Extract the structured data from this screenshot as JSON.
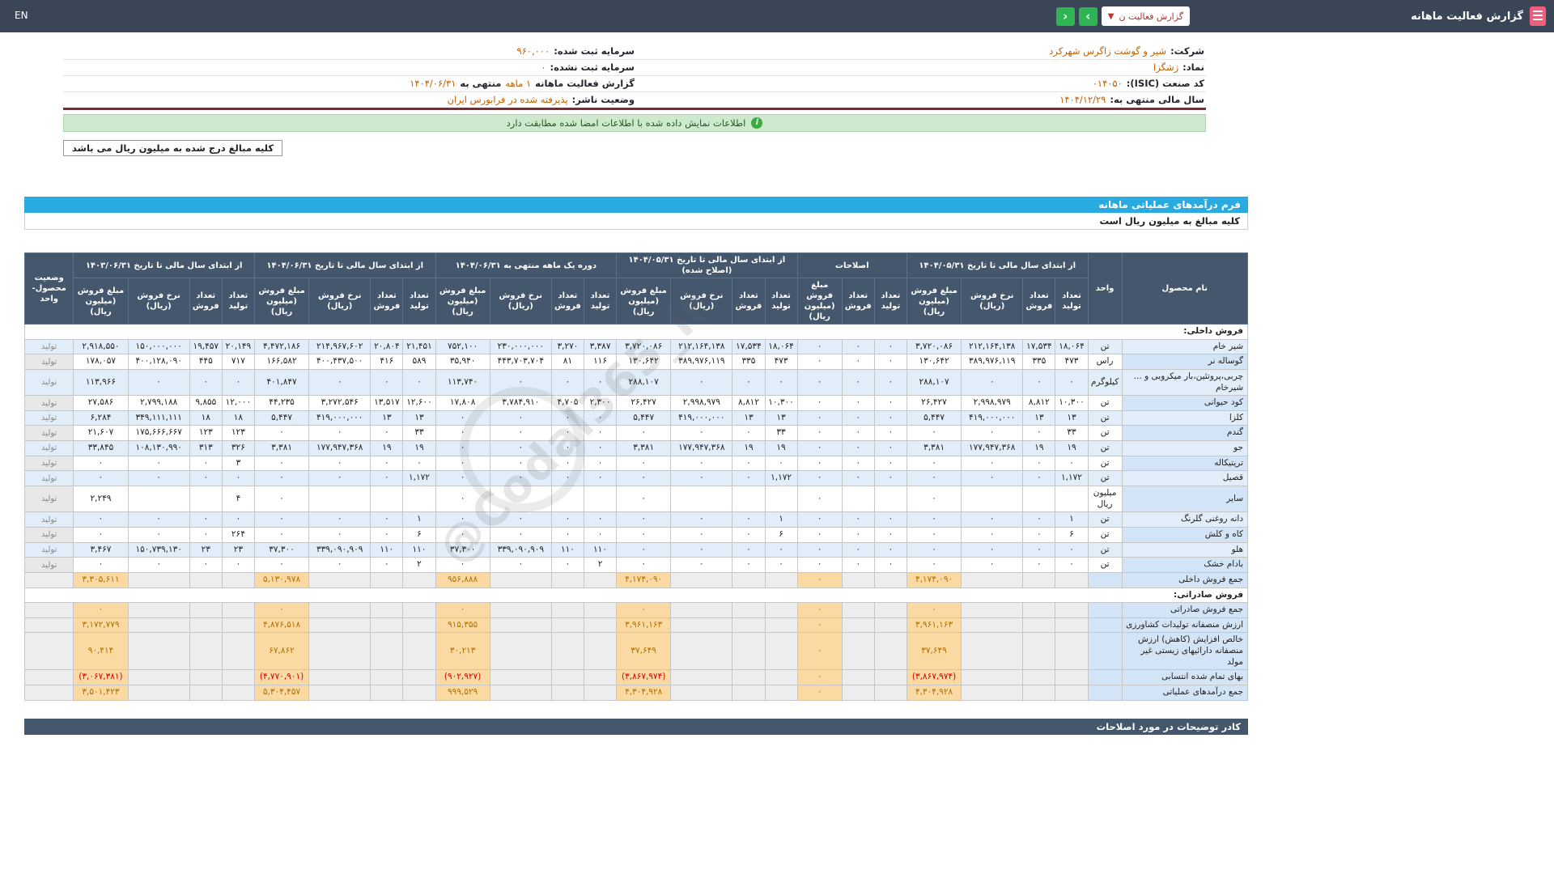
{
  "topbar": {
    "title": "گزارش فعالیت ماهانه",
    "dropdown_label": "گزارش فعالیت ن",
    "dropdown_caret": "▼",
    "nav_forward": "›",
    "nav_back": "‹",
    "lang": "EN"
  },
  "info_rows": [
    {
      "right": [
        [
          "شرکت:",
          "l"
        ],
        [
          "شیر و گوشت زاگرس شهرکرد",
          "v"
        ]
      ],
      "left": [
        [
          "سرمایه ثبت شده:",
          "l"
        ],
        [
          "۹۶۰,۰۰۰",
          "v"
        ]
      ]
    },
    {
      "right": [
        [
          "نماد:",
          "l"
        ],
        [
          "زشگزا",
          "v"
        ]
      ],
      "left": [
        [
          "سرمایه ثبت نشده:",
          "l"
        ],
        [
          "۰",
          "v"
        ]
      ]
    },
    {
      "right": [
        [
          "کد صنعت (ISIC):",
          "l"
        ],
        [
          "۰۱۴۰۵۰",
          "v"
        ]
      ],
      "left": [
        [
          "گزارش فعالیت ماهانه",
          "l"
        ],
        [
          "۱ ماهه",
          "v"
        ],
        [
          "منتهی به",
          "l"
        ],
        [
          "۱۴۰۴/۰۶/۳۱",
          "v"
        ]
      ]
    },
    {
      "right": [
        [
          "سال مالی منتهی به:",
          "l"
        ],
        [
          "۱۴۰۴/۱۲/۲۹",
          "v"
        ]
      ],
      "left": [
        [
          "وضعیت ناشر:",
          "l"
        ],
        [
          "پذیرفته شده در فرابورس ایران",
          "v"
        ]
      ]
    }
  ],
  "notice": "اطلاعات نمایش داده شده با اطلاعات امضا شده مطابقت دارد",
  "amounts_note_box": "کلیه مبالغ درج شده به میلیون ریال می باشد",
  "form": {
    "title": "فرم درآمدهای عملیاتی ماهانه",
    "subtitle": "کلیه مبالغ به میلیون ریال است"
  },
  "table": {
    "col_product": "نام محصول",
    "col_unit": "واحد",
    "col_status": "وضعیت محصول-واحد",
    "sub_headers": [
      "تعداد تولید",
      "تعداد فروش",
      "نرخ فروش (ریال)",
      "مبلغ فروش (میلیون ریال)"
    ],
    "adj_sub_headers": [
      "تعداد تولید",
      "تعداد فروش",
      "مبلغ فروش (میلیون ریال)"
    ],
    "groups": [
      "از ابتدای سال مالی تا تاریخ ۱۴۰۴/۰۵/۳۱",
      "اصلاحات",
      "از ابتدای سال مالی تا تاریخ ۱۴۰۴/۰۵/۳۱ (اصلاح شده)",
      "دوره یک ماهه منتهی به ۱۴۰۴/۰۶/۳۱",
      "از ابتدای سال مالی تا تاریخ ۱۴۰۴/۰۶/۳۱",
      "از ابتدای سال مالی تا تاریخ ۱۴۰۳/۰۶/۳۱"
    ],
    "rows": [
      {
        "type": "section",
        "label": "فروش داخلی:"
      },
      {
        "type": "product",
        "name": "شیر خام",
        "unit": "تن",
        "g1": [
          "۱۸,۰۶۴",
          "۱۷,۵۳۴",
          "۲۱۲,۱۶۴,۱۳۸",
          "۳,۷۲۰,۰۸۶"
        ],
        "adj": [
          "۰",
          "۰",
          "۰"
        ],
        "g2": [
          "۱۸,۰۶۴",
          "۱۷,۵۳۴",
          "۲۱۲,۱۶۴,۱۳۸",
          "۳,۷۲۰,۰۸۶"
        ],
        "month": [
          "۳,۳۸۷",
          "۳,۲۷۰",
          "۲۳۰,۰۰۰,۰۰۰",
          "۷۵۲,۱۰۰"
        ],
        "ytd": [
          "۲۱,۴۵۱",
          "۲۰,۸۰۴",
          "۲۱۴,۹۶۷,۶۰۲",
          "۴,۴۷۲,۱۸۶"
        ],
        "prev": [
          "۲۰,۱۴۹",
          "۱۹,۴۵۷",
          "۱۵۰,۰۰۰,۰۰۰",
          "۲,۹۱۸,۵۵۰"
        ],
        "status": "تولید"
      },
      {
        "type": "product",
        "name": "گوساله نر",
        "unit": "راس",
        "g1": [
          "۴۷۳",
          "۳۳۵",
          "۳۸۹,۹۷۶,۱۱۹",
          "۱۳۰,۶۴۲"
        ],
        "adj": [
          "۰",
          "۰",
          "۰"
        ],
        "g2": [
          "۴۷۳",
          "۳۳۵",
          "۳۸۹,۹۷۶,۱۱۹",
          "۱۳۰,۶۴۲"
        ],
        "month": [
          "۱۱۶",
          "۸۱",
          "۴۴۳,۷۰۳,۷۰۴",
          "۳۵,۹۴۰"
        ],
        "ytd": [
          "۵۸۹",
          "۴۱۶",
          "۴۰۰,۴۳۷,۵۰۰",
          "۱۶۶,۵۸۲"
        ],
        "prev": [
          "۷۱۷",
          "۴۴۵",
          "۴۰۰,۱۲۸,۰۹۰",
          "۱۷۸,۰۵۷"
        ],
        "status": "تولید"
      },
      {
        "type": "product",
        "name": "چربی،پروتئین،بار میکروبی و ... شیرخام",
        "unit": "کیلوگرم",
        "g1": [
          "۰",
          "۰",
          "۰",
          "۲۸۸,۱۰۷"
        ],
        "adj": [
          "۰",
          "۰",
          "۰"
        ],
        "g2": [
          "۰",
          "۰",
          "۰",
          "۲۸۸,۱۰۷"
        ],
        "month": [
          "۰",
          "۰",
          "۰",
          "۱۱۳,۷۴۰"
        ],
        "ytd": [
          "۰",
          "۰",
          "۰",
          "۴۰۱,۸۴۷"
        ],
        "prev": [
          "۰",
          "۰",
          "۰",
          "۱۱۳,۹۶۶"
        ],
        "status": "تولید"
      },
      {
        "type": "product",
        "name": "کود حیوانی",
        "unit": "تن",
        "g1": [
          "۱۰,۳۰۰",
          "۸,۸۱۲",
          "۲,۹۹۸,۹۷۹",
          "۲۶,۴۲۷"
        ],
        "adj": [
          "۰",
          "۰",
          "۰"
        ],
        "g2": [
          "۱۰,۳۰۰",
          "۸,۸۱۲",
          "۲,۹۹۸,۹۷۹",
          "۲۶,۴۲۷"
        ],
        "month": [
          "۲,۳۰۰",
          "۴,۷۰۵",
          "۳,۷۸۴,۹۱۰",
          "۱۷,۸۰۸"
        ],
        "ytd": [
          "۱۲,۶۰۰",
          "۱۳,۵۱۷",
          "۳,۲۷۲,۵۴۶",
          "۴۴,۲۳۵"
        ],
        "prev": [
          "۱۲,۰۰۰",
          "۹,۸۵۵",
          "۲,۷۹۹,۱۸۸",
          "۲۷,۵۸۶"
        ],
        "status": "تولید"
      },
      {
        "type": "product",
        "name": "کلزا",
        "unit": "تن",
        "g1": [
          "۱۳",
          "۱۳",
          "۴۱۹,۰۰۰,۰۰۰",
          "۵,۴۴۷"
        ],
        "adj": [
          "۰",
          "۰",
          "۰"
        ],
        "g2": [
          "۱۳",
          "۱۳",
          "۴۱۹,۰۰۰,۰۰۰",
          "۵,۴۴۷"
        ],
        "month": [
          "۰",
          "۰",
          "۰",
          "۰"
        ],
        "ytd": [
          "۱۳",
          "۱۳",
          "۴۱۹,۰۰۰,۰۰۰",
          "۵,۴۴۷"
        ],
        "prev": [
          "۱۸",
          "۱۸",
          "۳۴۹,۱۱۱,۱۱۱",
          "۶,۲۸۴"
        ],
        "status": "تولید"
      },
      {
        "type": "product",
        "name": "گندم",
        "unit": "تن",
        "g1": [
          "۳۳",
          "۰",
          "۰",
          "۰"
        ],
        "adj": [
          "۰",
          "۰",
          "۰"
        ],
        "g2": [
          "۳۳",
          "۰",
          "۰",
          "۰"
        ],
        "month": [
          "۰",
          "۰",
          "۰",
          "۰"
        ],
        "ytd": [
          "۳۳",
          "۰",
          "۰",
          "۰"
        ],
        "prev": [
          "۱۲۳",
          "۱۲۳",
          "۱۷۵,۶۶۶,۶۶۷",
          "۲۱,۶۰۷"
        ],
        "status": "تولید"
      },
      {
        "type": "product",
        "name": "جو",
        "unit": "تن",
        "g1": [
          "۱۹",
          "۱۹",
          "۱۷۷,۹۴۷,۳۶۸",
          "۳,۳۸۱"
        ],
        "adj": [
          "۰",
          "۰",
          "۰"
        ],
        "g2": [
          "۱۹",
          "۱۹",
          "۱۷۷,۹۴۷,۳۶۸",
          "۳,۳۸۱"
        ],
        "month": [
          "۰",
          "۰",
          "۰",
          "۰"
        ],
        "ytd": [
          "۱۹",
          "۱۹",
          "۱۷۷,۹۴۷,۳۶۸",
          "۳,۳۸۱"
        ],
        "prev": [
          "۳۲۶",
          "۳۱۳",
          "۱۰۸,۱۳۰,۹۹۰",
          "۳۳,۸۴۵"
        ],
        "status": "تولید"
      },
      {
        "type": "product",
        "name": "تریتیکاله",
        "unit": "تن",
        "g1": [
          "۰",
          "۰",
          "۰",
          "۰"
        ],
        "adj": [
          "۰",
          "۰",
          "۰"
        ],
        "g2": [
          "۰",
          "۰",
          "۰",
          "۰"
        ],
        "month": [
          "۰",
          "۰",
          "۰",
          "۰"
        ],
        "ytd": [
          "۰",
          "۰",
          "۰",
          "۰"
        ],
        "prev": [
          "۳",
          "۰",
          "۰",
          "۰"
        ],
        "status": "تولید"
      },
      {
        "type": "product",
        "name": "قصیل",
        "unit": "تن",
        "g1": [
          "۱,۱۷۲",
          "۰",
          "۰",
          "۰"
        ],
        "adj": [
          "۰",
          "۰",
          "۰"
        ],
        "g2": [
          "۱,۱۷۲",
          "۰",
          "۰",
          "۰"
        ],
        "month": [
          "۰",
          "۰",
          "۰",
          "۰"
        ],
        "ytd": [
          "۱,۱۷۲",
          "۰",
          "۰",
          "۰"
        ],
        "prev": [
          "۰",
          "۰",
          "۰",
          "۰"
        ],
        "status": "تولید"
      },
      {
        "type": "product",
        "name": "سایر",
        "unit": "میلیون ریال",
        "g1": [
          "",
          "",
          "",
          "۰"
        ],
        "adj": [
          "",
          "",
          "۰"
        ],
        "g2": [
          "",
          "",
          "",
          "۰"
        ],
        "month": [
          "",
          "",
          "",
          "۰"
        ],
        "ytd": [
          "",
          "",
          "",
          "۰"
        ],
        "prev": [
          "۴",
          "",
          "",
          "۲,۲۴۹"
        ],
        "status": "تولید"
      },
      {
        "type": "product",
        "name": "دانه روغنی گلرنگ",
        "unit": "تن",
        "g1": [
          "۱",
          "۰",
          "۰",
          "۰"
        ],
        "adj": [
          "۰",
          "۰",
          "۰"
        ],
        "g2": [
          "۱",
          "۰",
          "۰",
          "۰"
        ],
        "month": [
          "۰",
          "۰",
          "۰",
          "۰"
        ],
        "ytd": [
          "۱",
          "۰",
          "۰",
          "۰"
        ],
        "prev": [
          "۰",
          "۰",
          "۰",
          "۰"
        ],
        "status": "تولید"
      },
      {
        "type": "product",
        "name": "کاه و کلش",
        "unit": "تن",
        "g1": [
          "۶",
          "۰",
          "۰",
          "۰"
        ],
        "adj": [
          "۰",
          "۰",
          "۰"
        ],
        "g2": [
          "۶",
          "۰",
          "۰",
          "۰"
        ],
        "month": [
          "۰",
          "۰",
          "۰",
          "۰"
        ],
        "ytd": [
          "۶",
          "۰",
          "۰",
          "۰"
        ],
        "prev": [
          "۲۶۴",
          "۰",
          "۰",
          "۰"
        ],
        "status": "تولید"
      },
      {
        "type": "product",
        "name": "هلو",
        "unit": "تن",
        "g1": [
          "۰",
          "۰",
          "۰",
          "۰"
        ],
        "adj": [
          "۰",
          "۰",
          "۰"
        ],
        "g2": [
          "۰",
          "۰",
          "۰",
          "۰"
        ],
        "month": [
          "۱۱۰",
          "۱۱۰",
          "۳۳۹,۰۹۰,۹۰۹",
          "۳۷,۳۰۰"
        ],
        "ytd": [
          "۱۱۰",
          "۱۱۰",
          "۳۳۹,۰۹۰,۹۰۹",
          "۳۷,۳۰۰"
        ],
        "prev": [
          "۲۳",
          "۲۳",
          "۱۵۰,۷۳۹,۱۳۰",
          "۳,۴۶۷"
        ],
        "status": "تولید"
      },
      {
        "type": "product",
        "name": "بادام خشک",
        "unit": "تن",
        "g1": [
          "۰",
          "۰",
          "۰",
          "۰"
        ],
        "adj": [
          "۰",
          "۰",
          "۰"
        ],
        "g2": [
          "۰",
          "۰",
          "۰",
          "۰"
        ],
        "month": [
          "۲",
          "۰",
          "۰",
          "۰"
        ],
        "ytd": [
          "۲",
          "۰",
          "۰",
          "۰"
        ],
        "prev": [
          "۰",
          "۰",
          "۰",
          "۰"
        ],
        "status": "تولید"
      },
      {
        "type": "total",
        "label": "جمع فروش داخلی",
        "g1": "۴,۱۷۴,۰۹۰",
        "adj": "۰",
        "g2": "۴,۱۷۴,۰۹۰",
        "month": "۹۵۶,۸۸۸",
        "ytd": "۵,۱۳۰,۹۷۸",
        "prev": "۳,۳۰۵,۶۱۱"
      },
      {
        "type": "section",
        "label": "فروش صادراتی:"
      },
      {
        "type": "total",
        "label": "جمع فروش صادراتی",
        "g1": "۰",
        "adj": "۰",
        "g2": "۰",
        "month": "۰",
        "ytd": "۰",
        "prev": "۰"
      },
      {
        "type": "total",
        "label": "ارزش منصفانه تولیدات کشاورزی",
        "g1": "۳,۹۶۱,۱۶۳",
        "adj": "۰",
        "g2": "۳,۹۶۱,۱۶۳",
        "month": "۹۱۵,۳۵۵",
        "ytd": "۴,۸۷۶,۵۱۸",
        "prev": "۳,۱۷۲,۷۷۹"
      },
      {
        "type": "total",
        "label": "خالص افزایش (کاهش) ارزش منصفانه دارائیهای زیستی غیر مولد",
        "g1": "۳۷,۶۴۹",
        "adj": "۰",
        "g2": "۳۷,۶۴۹",
        "month": "۳۰,۲۱۳",
        "ytd": "۶۷,۸۶۲",
        "prev": "۹۰,۴۱۴"
      },
      {
        "type": "total",
        "label": "بهای تمام شده انتسابی",
        "g1": "(۳,۸۶۷,۹۷۴)",
        "adj": "۰",
        "g2": "(۳,۸۶۷,۹۷۴)",
        "month": "(۹۰۲,۹۲۷)",
        "ytd": "(۴,۷۷۰,۹۰۱)",
        "prev": "(۳,۰۶۷,۳۸۱)"
      },
      {
        "type": "total",
        "label": "جمع درآمدهای عملیاتی",
        "g1": "۴,۳۰۴,۹۲۸",
        "adj": "۰",
        "g2": "۴,۳۰۴,۹۲۸",
        "month": "۹۹۹,۵۲۹",
        "ytd": "۵,۳۰۴,۴۵۷",
        "prev": "۳,۵۰۱,۴۲۳"
      }
    ]
  },
  "footer_bar": "کادر توضیحات در مورد اصلاحات",
  "watermark": "@Codal365_ir",
  "colors": {
    "topbar": "#3a4656",
    "table_header": "#44576d",
    "accent_blue": "#29abe2",
    "highlight_orange": "#fbd9a3",
    "amount_text": "#b06f00",
    "negative_red": "#d60000",
    "value_orange": "#bf5f00",
    "notice_green_bg": "#cfe9cf",
    "maroon_line": "#7d2b30",
    "nav_green": "#2eb453",
    "icon_pink": "#ee5e7d"
  }
}
